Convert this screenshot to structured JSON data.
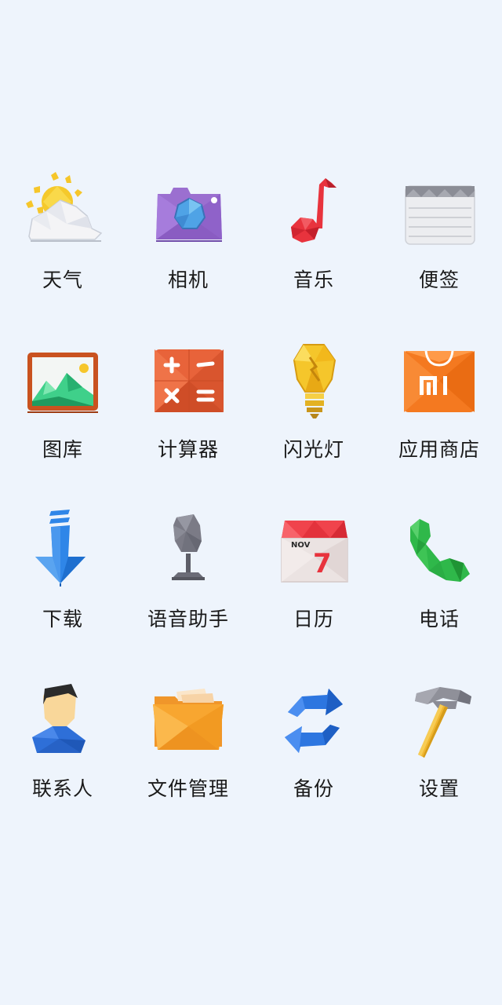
{
  "apps": [
    {
      "label": "天气",
      "icon": "weather-icon"
    },
    {
      "label": "相机",
      "icon": "camera-icon"
    },
    {
      "label": "音乐",
      "icon": "music-icon"
    },
    {
      "label": "便签",
      "icon": "notes-icon"
    },
    {
      "label": "图库",
      "icon": "gallery-icon"
    },
    {
      "label": "计算器",
      "icon": "calculator-icon"
    },
    {
      "label": "闪光灯",
      "icon": "flashlight-icon"
    },
    {
      "label": "应用商店",
      "icon": "app-store-icon"
    },
    {
      "label": "下载",
      "icon": "download-icon"
    },
    {
      "label": "语音助手",
      "icon": "voice-assistant-icon"
    },
    {
      "label": "日历",
      "icon": "calendar-icon"
    },
    {
      "label": "电话",
      "icon": "phone-icon"
    },
    {
      "label": "联系人",
      "icon": "contacts-icon"
    },
    {
      "label": "文件管理",
      "icon": "file-manager-icon"
    },
    {
      "label": "备份",
      "icon": "backup-icon"
    },
    {
      "label": "设置",
      "icon": "settings-icon"
    }
  ],
  "calendar_icon": {
    "month": "NOV",
    "day": "7"
  },
  "store_icon": {
    "brand": "MI"
  },
  "colors": {
    "background": "#eef4fc",
    "camera": "#9b6fd0",
    "music": "#e8333d",
    "gallery_frame": "#c9521f",
    "calculator": "#e8633a",
    "flashlight": "#f5c62b",
    "store": "#f47920",
    "download": "#2f86e8",
    "voice": "#7b7b86",
    "calendar_red": "#f0434c",
    "phone": "#2fb84a",
    "contacts": "#2e6fd8",
    "folder": "#f8a630",
    "backup": "#2d76e0",
    "settings_handle": "#f0b630"
  }
}
